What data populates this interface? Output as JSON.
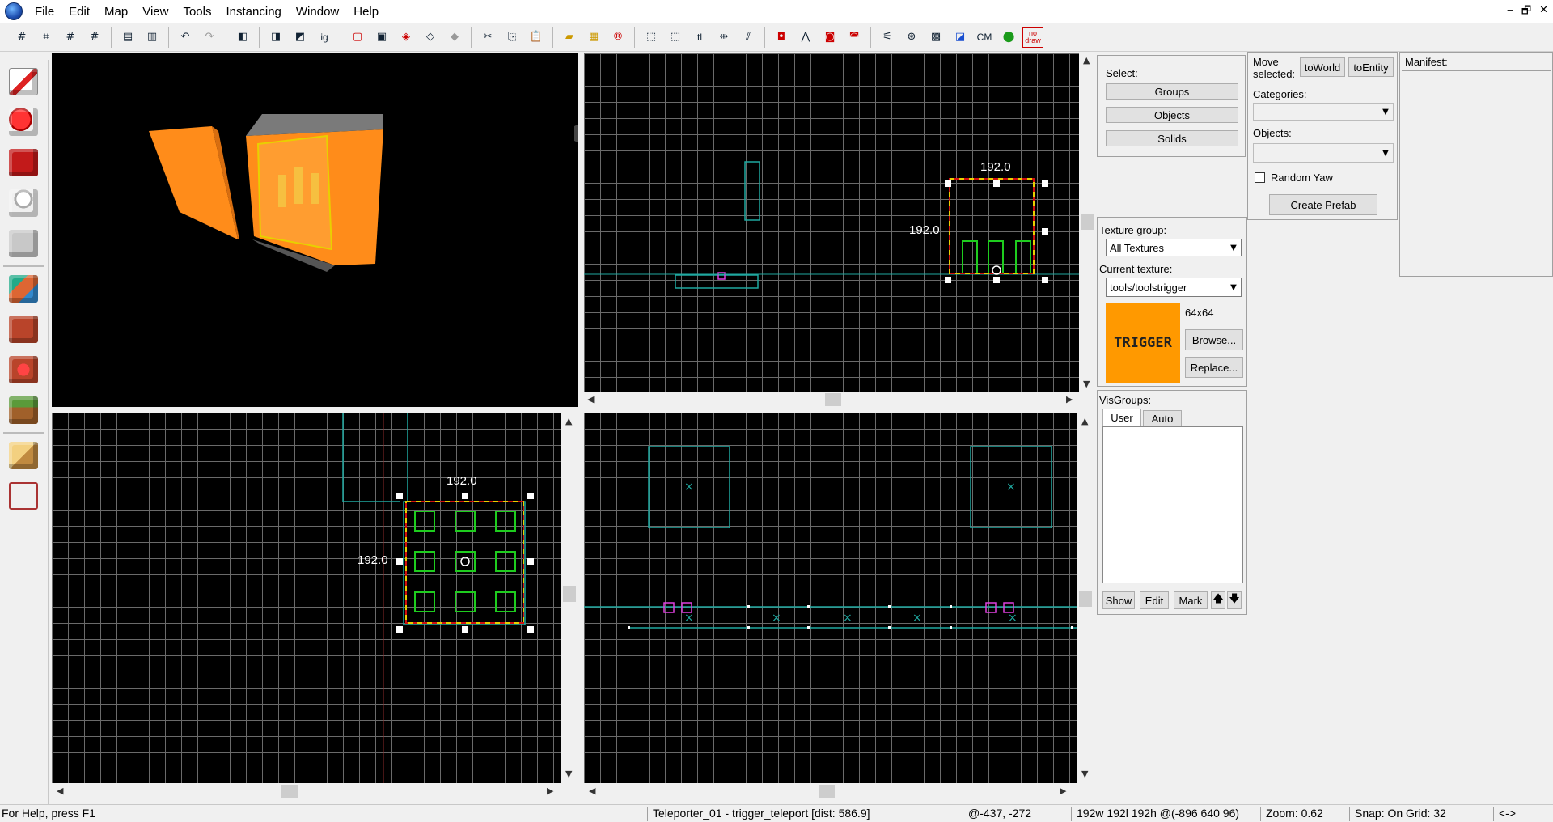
{
  "menu": [
    "File",
    "Edit",
    "Map",
    "View",
    "Tools",
    "Instancing",
    "Window",
    "Help"
  ],
  "window_controls": {
    "minimize": "–",
    "restore": "🗗",
    "close": "✕"
  },
  "toolbar": {
    "cm_label": "CM",
    "nodraw_label": "no draw"
  },
  "viewports": {
    "top_dim_w": "192.0",
    "top_dim_h": "192.0",
    "front_dim_w": "192.0",
    "front_dim_h": "192.0"
  },
  "select_panel": {
    "label": "Select:",
    "groups": "Groups",
    "objects": "Objects",
    "solids": "Solids"
  },
  "texture_panel": {
    "group_label": "Texture group:",
    "group_value": "All Textures",
    "current_label": "Current texture:",
    "current_value": "tools/toolstrigger",
    "preview_text": "TRIGGER",
    "preview_color": "#ff9900",
    "size": "64x64",
    "browse": "Browse...",
    "replace": "Replace..."
  },
  "visgroups": {
    "label": "VisGroups:",
    "tab_user": "User",
    "tab_auto": "Auto",
    "show": "Show",
    "edit": "Edit",
    "mark": "Mark",
    "up": "🡅",
    "down": "🡇"
  },
  "move_panel": {
    "label": "Move selected:",
    "to_world": "toWorld",
    "to_entity": "toEntity",
    "categories_label": "Categories:",
    "objects_label": "Objects:",
    "random_yaw": "Random Yaw",
    "create_prefab": "Create Prefab"
  },
  "manifest": {
    "label": "Manifest:"
  },
  "status": {
    "help": "For Help, press F1",
    "selection": "Teleporter_01 - trigger_teleport  [dist: 586.9]",
    "coords": "@-437, -272",
    "size": "192w 192l 192h @(-896 640 96)",
    "zoom": "Zoom: 0.62",
    "snap": "Snap: On Grid: 32",
    "arrows": "<->"
  },
  "colors": {
    "selection_yellow": "#e8d000",
    "selection_red": "#d01010",
    "entity_green": "#1ecc1e",
    "brush_cyan": "#1fa8a0",
    "entity_magenta": "#e040e0",
    "grid": "#6a6a6a"
  }
}
